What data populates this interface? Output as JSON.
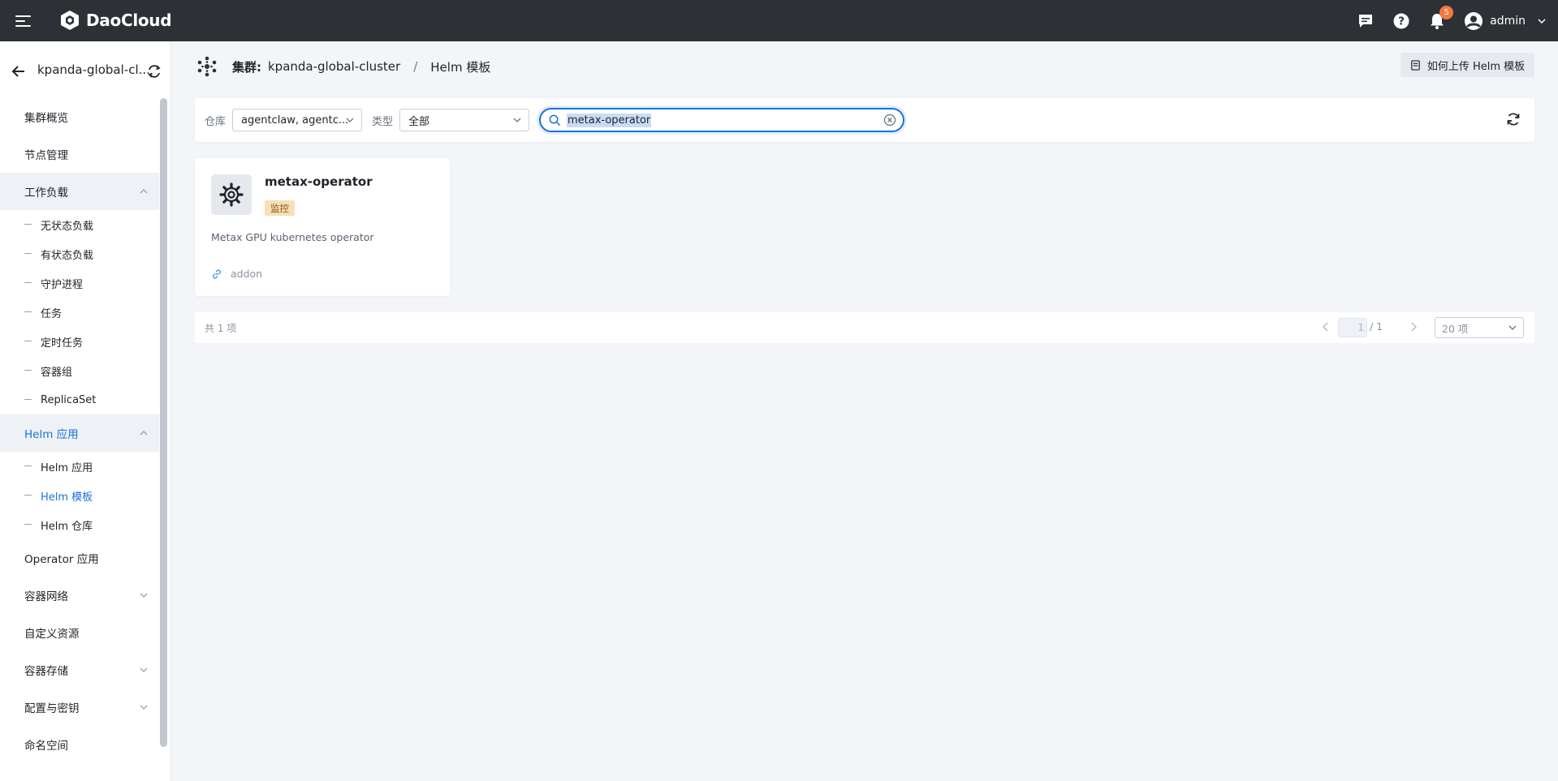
{
  "topbar": {
    "brand": "DaoCloud",
    "notification_count": "5",
    "user": "admin",
    "icons": [
      "menu-icon",
      "chat-icon",
      "help-icon",
      "bell-icon",
      "user-avatar-icon",
      "chevron-down-icon"
    ]
  },
  "sidebar": {
    "cluster_name": "kpanda-global-cl...",
    "items": [
      {
        "label": "集群概览"
      },
      {
        "label": "节点管理"
      },
      {
        "label": "工作负载",
        "sub": [
          {
            "label": "无状态负载"
          },
          {
            "label": "有状态负载"
          },
          {
            "label": "守护进程"
          },
          {
            "label": "任务"
          },
          {
            "label": "定时任务"
          },
          {
            "label": "容器组"
          },
          {
            "label": "ReplicaSet"
          }
        ]
      },
      {
        "label": "Helm 应用",
        "sub": [
          {
            "label": "Helm 应用"
          },
          {
            "label": "Helm 模板",
            "active": true
          },
          {
            "label": "Helm 仓库"
          }
        ]
      },
      {
        "label": "Operator 应用"
      },
      {
        "label": "容器网络"
      },
      {
        "label": "自定义资源"
      },
      {
        "label": "容器存储"
      },
      {
        "label": "配置与密钥"
      },
      {
        "label": "命名空间"
      }
    ]
  },
  "header": {
    "label": "集群:",
    "cluster": "kpanda-global-cluster",
    "separator": "/",
    "page": "Helm 模板",
    "how_to_upload": "如何上传 Helm 模板"
  },
  "filters": {
    "repo_label": "仓库",
    "repo_value": "agentclaw, agentc...",
    "type_label": "类型",
    "type_value": "全部",
    "search_value": "metax-operator"
  },
  "cards": [
    {
      "title": "metax-operator",
      "tag": "监控",
      "description": "Metax GPU kubernetes operator",
      "repo": "addon"
    }
  ],
  "pagination": {
    "total": "共 1 项",
    "current_page": "1",
    "page_of": "/ 1",
    "page_size": "20 项"
  },
  "colors": {
    "topbar": "#2d3035",
    "accent": "#1a73d9",
    "tag_bg": "#f6dfb9",
    "badge": "#f5783d"
  }
}
